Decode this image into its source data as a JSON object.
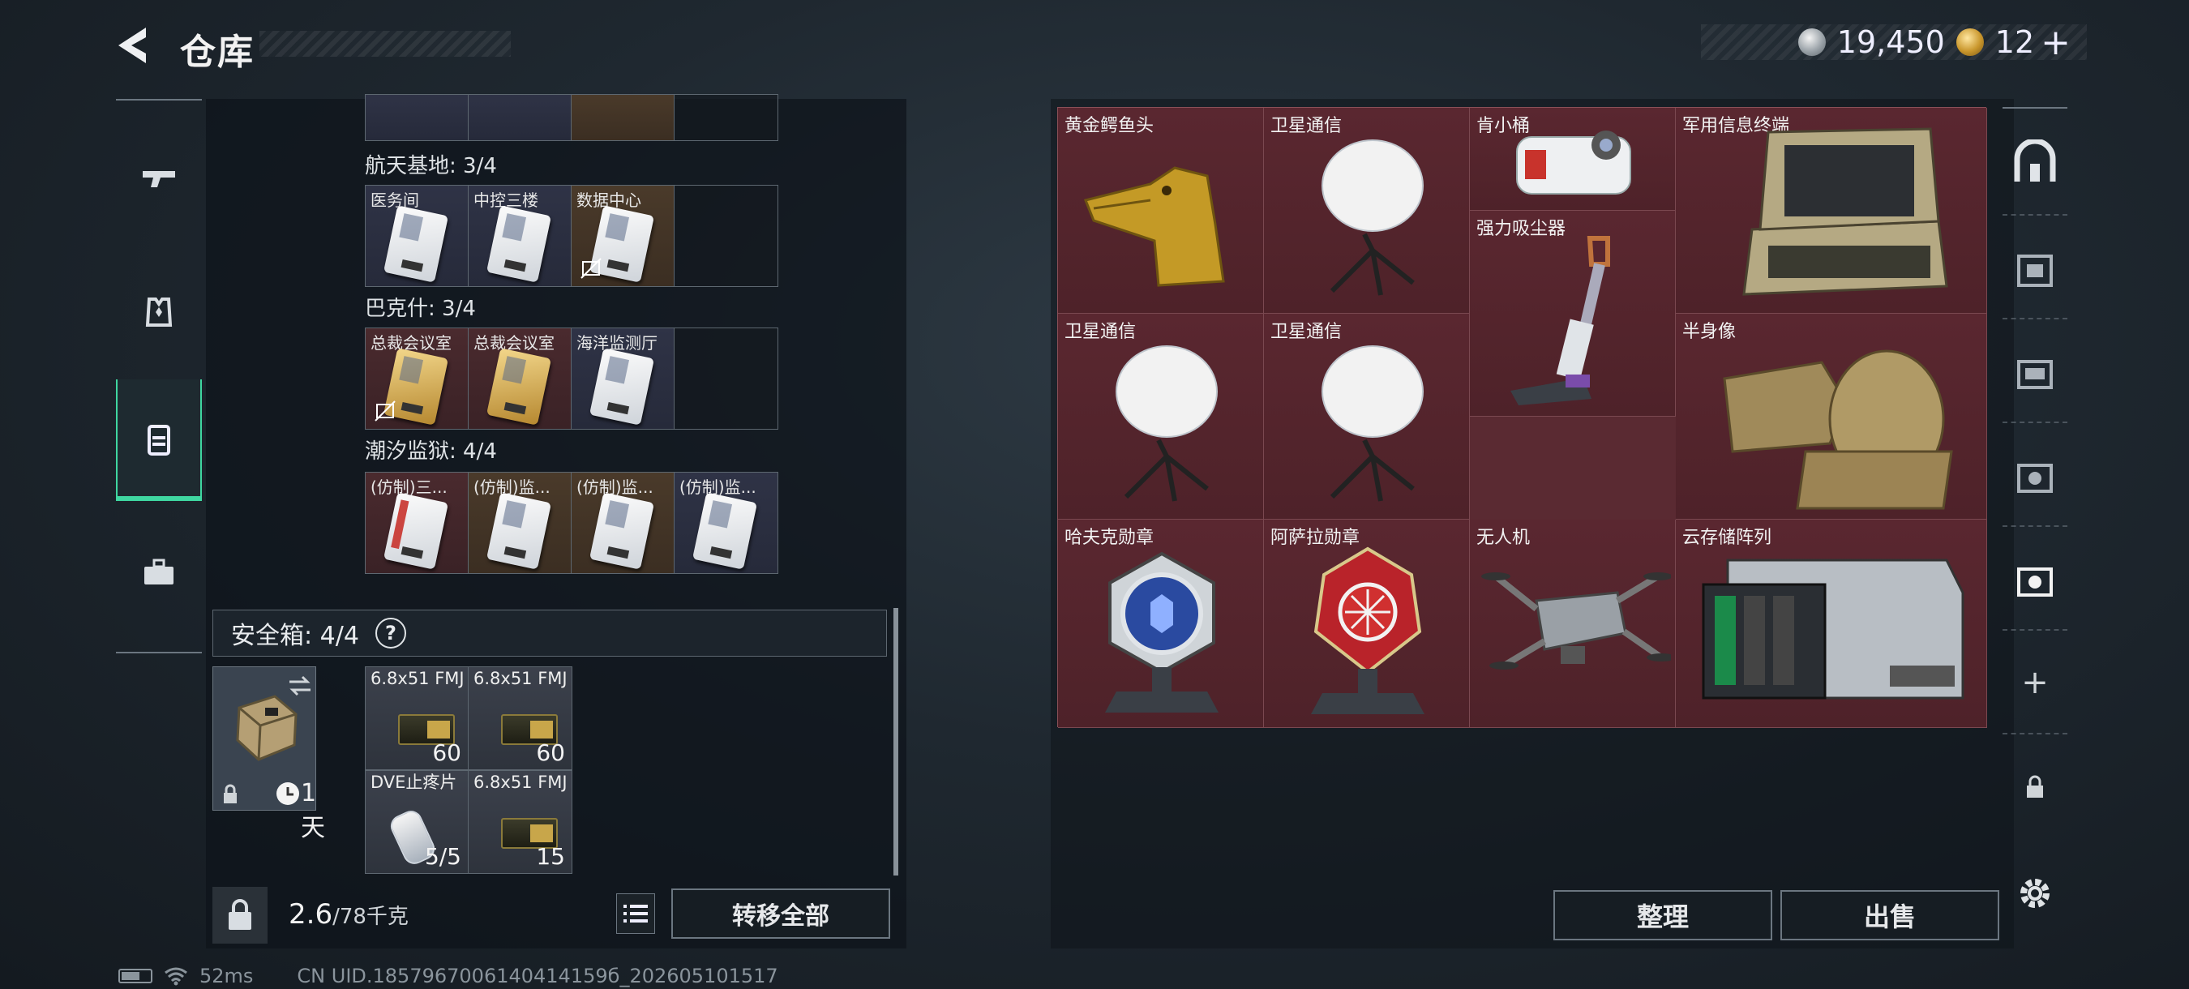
{
  "header": {
    "title": "仓库",
    "silver_amount": "19,450",
    "gold_amount": "12",
    "gold_plus": "+"
  },
  "left_tabs": [
    "weapon-tab",
    "armor-tab",
    "backpack-tab",
    "toolbox-tab"
  ],
  "keycards": {
    "groups": [
      {
        "title": "航天基地: 3/4",
        "cards": [
          "医务间",
          "中控三楼",
          "数据中心",
          ""
        ]
      },
      {
        "title": "巴克什: 3/4",
        "cards": [
          "总裁会议室",
          "总裁会议室",
          "海洋监测厅",
          ""
        ]
      },
      {
        "title": "潮汐监狱: 4/4",
        "cards": [
          "(仿制)三...",
          "(仿制)监...",
          "(仿制)监...",
          "(仿制)监..."
        ]
      }
    ]
  },
  "safe_box": {
    "label": "安全箱: 4/4",
    "help": "?",
    "duration": "1天",
    "items": [
      {
        "name": "6.8x51 FMJ",
        "count": "60"
      },
      {
        "name": "6.8x51 FMJ",
        "count": "60"
      },
      {
        "name": "DVE止疼片",
        "count": "5/5"
      },
      {
        "name": "6.8x51 FMJ",
        "count": "15"
      }
    ]
  },
  "footer_left": {
    "weight_value": "2.6",
    "weight_max": "/78千克",
    "transfer_label": "转移全部",
    "lock_label": "KG"
  },
  "storage_items": [
    {
      "label": "黄金鳄鱼头"
    },
    {
      "label": "卫星通信"
    },
    {
      "label": "肯小桶"
    },
    {
      "label": "军用信息终端"
    },
    {
      "label": "强力吸尘器"
    },
    {
      "label": "卫星通信"
    },
    {
      "label": "卫星通信"
    },
    {
      "label": "半身像"
    },
    {
      "label": "哈夫克勋章"
    },
    {
      "label": "阿萨拉勋章"
    },
    {
      "label": "无人机"
    },
    {
      "label": "云存储阵列"
    }
  ],
  "actions": {
    "organize": "整理",
    "sell": "出售"
  },
  "right_tabs": {
    "add": "+",
    "lock": "lock-icon"
  },
  "status_bar": {
    "ping": "52ms",
    "uid": "CN UID.1857967006140414159б_202605101517"
  },
  "colors": {
    "accent": "#3fd6a0",
    "item_bg": "#5a2730"
  }
}
